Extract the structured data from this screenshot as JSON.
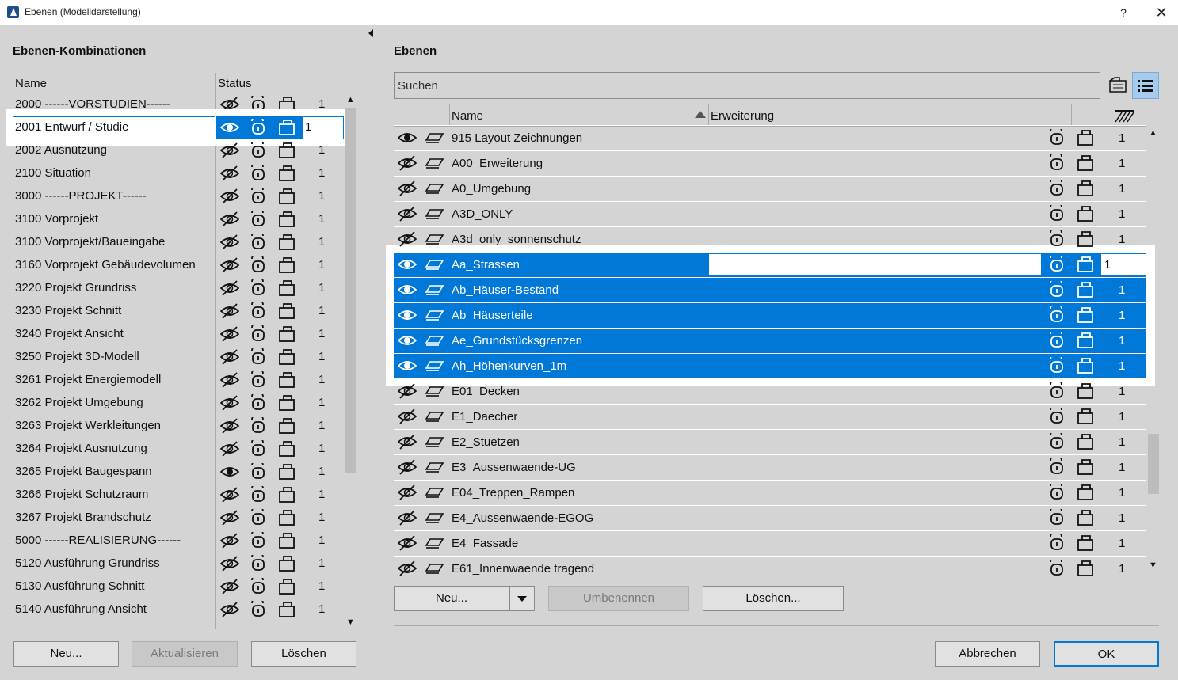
{
  "window": {
    "title": "Ebenen (Modelldarstellung)",
    "help": "?",
    "close": "✕"
  },
  "left": {
    "heading": "Ebenen-Kombinationen",
    "col_name": "Name",
    "col_status": "Status",
    "rows": [
      {
        "name": "2000 ------VORSTUDIEN------",
        "num": "1",
        "visible": false
      },
      {
        "name": "2001 Entwurf / Studie",
        "num": "1",
        "visible": true,
        "selected": true
      },
      {
        "name": "2002 Ausnützung",
        "num": "1",
        "visible": false
      },
      {
        "name": "2100 Situation",
        "num": "1",
        "visible": false
      },
      {
        "name": "3000 ------PROJEKT------",
        "num": "1",
        "visible": false
      },
      {
        "name": "3100 Vorprojekt",
        "num": "1",
        "visible": false
      },
      {
        "name": "3100 Vorprojekt/Baueingabe",
        "num": "1",
        "visible": false
      },
      {
        "name": "3160 Vorprojekt Gebäudevolumen",
        "num": "1",
        "visible": false
      },
      {
        "name": "3220 Projekt Grundriss",
        "num": "1",
        "visible": false
      },
      {
        "name": "3230 Projekt Schnitt",
        "num": "1",
        "visible": false
      },
      {
        "name": "3240 Projekt Ansicht",
        "num": "1",
        "visible": false
      },
      {
        "name": "3250 Projekt 3D-Modell",
        "num": "1",
        "visible": false
      },
      {
        "name": "3261 Projekt Energiemodell",
        "num": "1",
        "visible": false
      },
      {
        "name": "3262 Projekt Umgebung",
        "num": "1",
        "visible": false
      },
      {
        "name": "3263 Projekt Werkleitungen",
        "num": "1",
        "visible": false
      },
      {
        "name": "3264 Projekt Ausnutzung",
        "num": "1",
        "visible": false
      },
      {
        "name": "3265 Projekt Baugespann",
        "num": "1",
        "visible": true
      },
      {
        "name": "3266 Projekt Schutzraum",
        "num": "1",
        "visible": false
      },
      {
        "name": "3267 Projekt Brandschutz",
        "num": "1",
        "visible": false
      },
      {
        "name": "5000 ------REALISIERUNG------",
        "num": "1",
        "visible": false
      },
      {
        "name": "5120 Ausführung Grundriss",
        "num": "1",
        "visible": false
      },
      {
        "name": "5130 Ausführung Schnitt",
        "num": "1",
        "visible": false
      },
      {
        "name": "5140 Ausführung Ansicht",
        "num": "1",
        "visible": false
      }
    ],
    "buttons": {
      "new": "Neu...",
      "update": "Aktualisieren",
      "delete": "Löschen"
    }
  },
  "right": {
    "heading": "Ebenen",
    "search_placeholder": "Suchen",
    "col_name": "Name",
    "col_ext": "Erweiterung",
    "rows": [
      {
        "name": "915 Layout Zeichnungen",
        "num": "1",
        "visible": true
      },
      {
        "name": "A00_Erweiterung",
        "num": "1",
        "visible": false
      },
      {
        "name": "A0_Umgebung",
        "num": "1",
        "visible": false
      },
      {
        "name": "A3D_ONLY",
        "num": "1",
        "visible": false
      },
      {
        "name": "A3d_only_sonnenschutz",
        "num": "1",
        "visible": false
      },
      {
        "name": "Aa_Strassen",
        "num": "1",
        "visible": true,
        "selected": true,
        "editing": true
      },
      {
        "name": "Ab_Häuser-Bestand",
        "num": "1",
        "visible": true,
        "selected": true
      },
      {
        "name": "Ab_Häuserteile",
        "num": "1",
        "visible": true,
        "selected": true
      },
      {
        "name": "Ae_Grundstücksgrenzen",
        "num": "1",
        "visible": true,
        "selected": true
      },
      {
        "name": "Ah_Höhenkurven_1m",
        "num": "1",
        "visible": true,
        "selected": true
      },
      {
        "name": "E01_Decken",
        "num": "1",
        "visible": false
      },
      {
        "name": "E1_Daecher",
        "num": "1",
        "visible": false
      },
      {
        "name": "E2_Stuetzen",
        "num": "1",
        "visible": false
      },
      {
        "name": "E3_Aussenwaende-UG",
        "num": "1",
        "visible": false
      },
      {
        "name": "E04_Treppen_Rampen",
        "num": "1",
        "visible": false
      },
      {
        "name": "E4_Aussenwaende-EGOG",
        "num": "1",
        "visible": false
      },
      {
        "name": "E4_Fassade",
        "num": "1",
        "visible": false
      },
      {
        "name": "E61_Innenwaende tragend",
        "num": "1",
        "visible": false
      }
    ],
    "buttons": {
      "new": "Neu...",
      "rename": "Umbenennen",
      "delete": "Löschen..."
    }
  },
  "dialog": {
    "cancel": "Abbrechen",
    "ok": "OK"
  }
}
